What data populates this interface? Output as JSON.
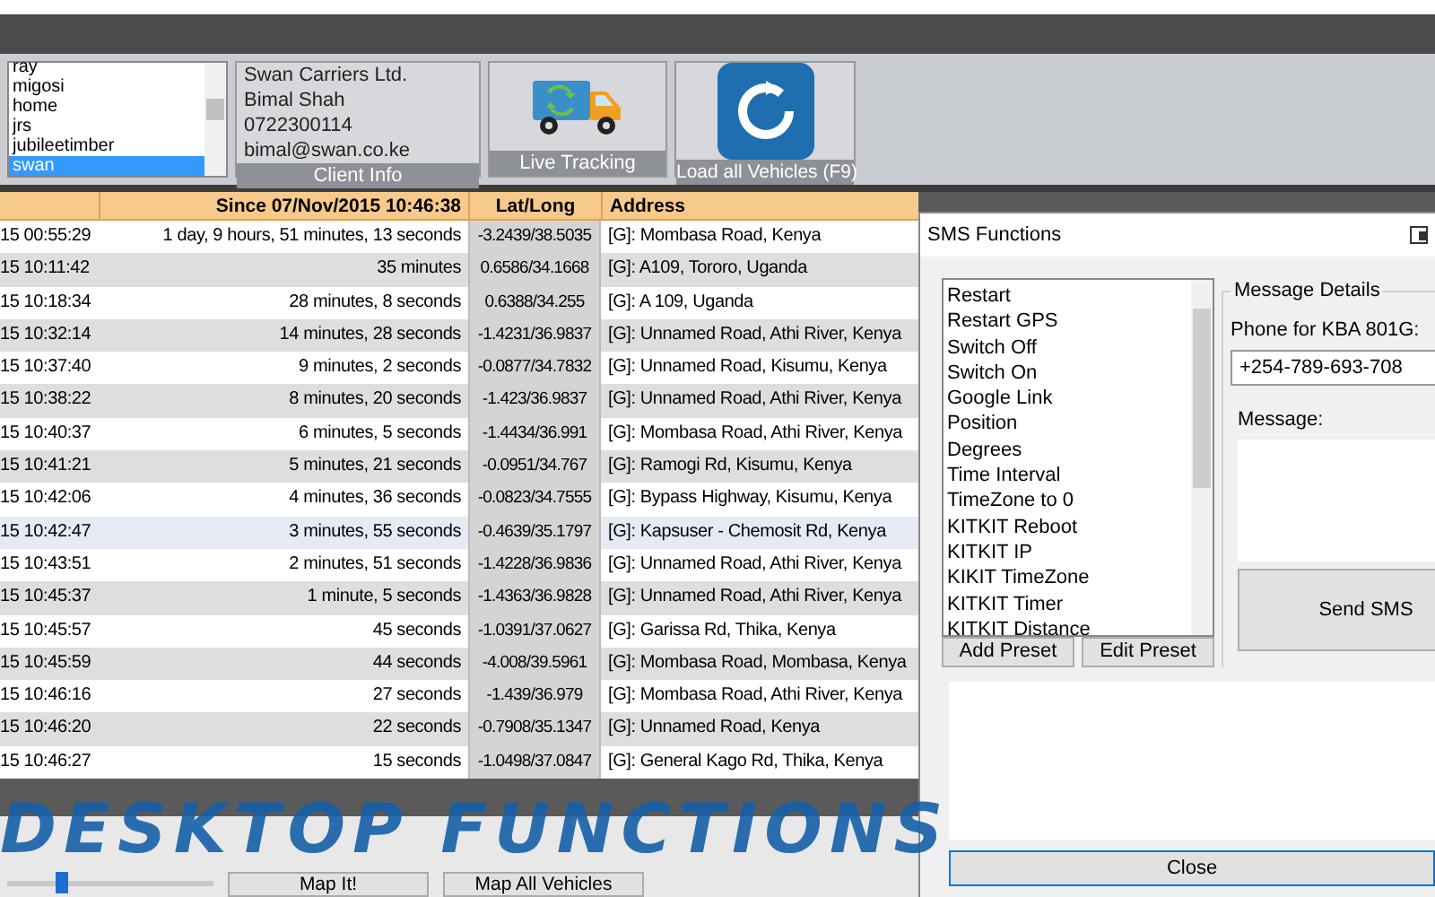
{
  "clients": {
    "items": [
      {
        "label": "ray",
        "selected": false
      },
      {
        "label": "migosi",
        "selected": false
      },
      {
        "label": "home",
        "selected": false
      },
      {
        "label": "jrs",
        "selected": false
      },
      {
        "label": "jubileetimber",
        "selected": false
      },
      {
        "label": "swan",
        "selected": true
      }
    ]
  },
  "client_info": {
    "lines": [
      "Swan Carriers Ltd.",
      "Bimal Shah",
      "0722300114",
      "bimal@swan.co.ke"
    ],
    "caption": "Client Info"
  },
  "live_tracking": {
    "caption": "Live Tracking"
  },
  "load_all": {
    "caption": "Load all Vehicles (F9)"
  },
  "table": {
    "columns": [
      "Since 07/Nov/2015 10:46:38",
      "Lat/Long",
      "Address"
    ],
    "rows": [
      {
        "time": "15 00:55:29",
        "since": "1 day, 9 hours, 51 minutes, 13 seconds",
        "latlong": "-3.2439/38.5035",
        "address": "[G]: Mombasa Road, Kenya",
        "selected": false
      },
      {
        "time": "15 10:11:42",
        "since": "35 minutes",
        "latlong": "0.6586/34.1668",
        "address": "[G]: A109, Tororo, Uganda",
        "selected": false
      },
      {
        "time": "15 10:18:34",
        "since": "28 minutes, 8 seconds",
        "latlong": "0.6388/34.255",
        "address": "[G]: A 109, Uganda",
        "selected": false
      },
      {
        "time": "15 10:32:14",
        "since": "14 minutes, 28 seconds",
        "latlong": "-1.4231/36.9837",
        "address": "[G]: Unnamed Road, Athi River, Kenya",
        "selected": false
      },
      {
        "time": "15 10:37:40",
        "since": "9 minutes, 2 seconds",
        "latlong": "-0.0877/34.7832",
        "address": "[G]: Unnamed Road, Kisumu, Kenya",
        "selected": false
      },
      {
        "time": "15 10:38:22",
        "since": "8 minutes, 20 seconds",
        "latlong": "-1.423/36.9837",
        "address": "[G]: Unnamed Road, Athi River, Kenya",
        "selected": false
      },
      {
        "time": "15 10:40:37",
        "since": "6 minutes, 5 seconds",
        "latlong": "-1.4434/36.991",
        "address": "[G]: Mombasa Road, Athi River, Kenya",
        "selected": false
      },
      {
        "time": "15 10:41:21",
        "since": "5 minutes, 21 seconds",
        "latlong": "-0.0951/34.767",
        "address": "[G]: Ramogi Rd, Kisumu, Kenya",
        "selected": false
      },
      {
        "time": "15 10:42:06",
        "since": "4 minutes, 36 seconds",
        "latlong": "-0.0823/34.7555",
        "address": "[G]: Bypass Highway, Kisumu, Kenya",
        "selected": false
      },
      {
        "time": "15 10:42:47",
        "since": "3 minutes, 55 seconds",
        "latlong": "-0.4639/35.1797",
        "address": "[G]: Kapsuser - Chemosit Rd, Kenya",
        "selected": true
      },
      {
        "time": "15 10:43:51",
        "since": "2 minutes, 51 seconds",
        "latlong": "-1.4228/36.9836",
        "address": "[G]: Unnamed Road, Athi River, Kenya",
        "selected": false
      },
      {
        "time": "15 10:45:37",
        "since": "1 minute, 5 seconds",
        "latlong": "-1.4363/36.9828",
        "address": "[G]: Unnamed Road, Athi River, Kenya",
        "selected": false
      },
      {
        "time": "15 10:45:57",
        "since": "45 seconds",
        "latlong": "-1.0391/37.0627",
        "address": "[G]: Garissa Rd, Thika, Kenya",
        "selected": false
      },
      {
        "time": "15 10:45:59",
        "since": "44 seconds",
        "latlong": "-4.008/39.5961",
        "address": "[G]: Mombasa Road, Mombasa, Kenya",
        "selected": false
      },
      {
        "time": "15 10:46:16",
        "since": "27 seconds",
        "latlong": "-1.439/36.979",
        "address": "[G]: Mombasa Road, Athi River, Kenya",
        "selected": false
      },
      {
        "time": "15 10:46:20",
        "since": "22 seconds",
        "latlong": "-0.7908/35.1347",
        "address": "[G]: Unnamed Road, Kenya",
        "selected": false
      },
      {
        "time": "15 10:46:27",
        "since": "15 seconds",
        "latlong": "-1.0498/37.0847",
        "address": "[G]: General Kago Rd, Thika, Kenya",
        "selected": false
      }
    ]
  },
  "bottom_bar": {
    "slider": {
      "level": 0.25
    },
    "buttons": [
      "Map It!",
      "Map All Vehicles"
    ]
  },
  "sms_dialog": {
    "title": "SMS Functions",
    "presets": [
      "Restart",
      "Restart GPS",
      "Switch Off",
      "Switch On",
      "Google Link",
      "Position",
      "Degrees",
      "Time Interval",
      "TimeZone to 0",
      "KITKIT Reboot",
      "KITKIT IP",
      "KIKIT TimeZone",
      "KITKIT Timer",
      "KITKIT Distance"
    ],
    "preset_buttons": [
      "Add Preset",
      "Edit Preset"
    ],
    "group_title": "Message Details",
    "phone_label": "Phone for KBA 801G:",
    "phone_value": "+254-789-693-708",
    "message_label": "Message:",
    "send_button": "Send SMS",
    "close_button": "Close"
  },
  "overlay_caption": "DESKTOP FUNCTIONS"
}
